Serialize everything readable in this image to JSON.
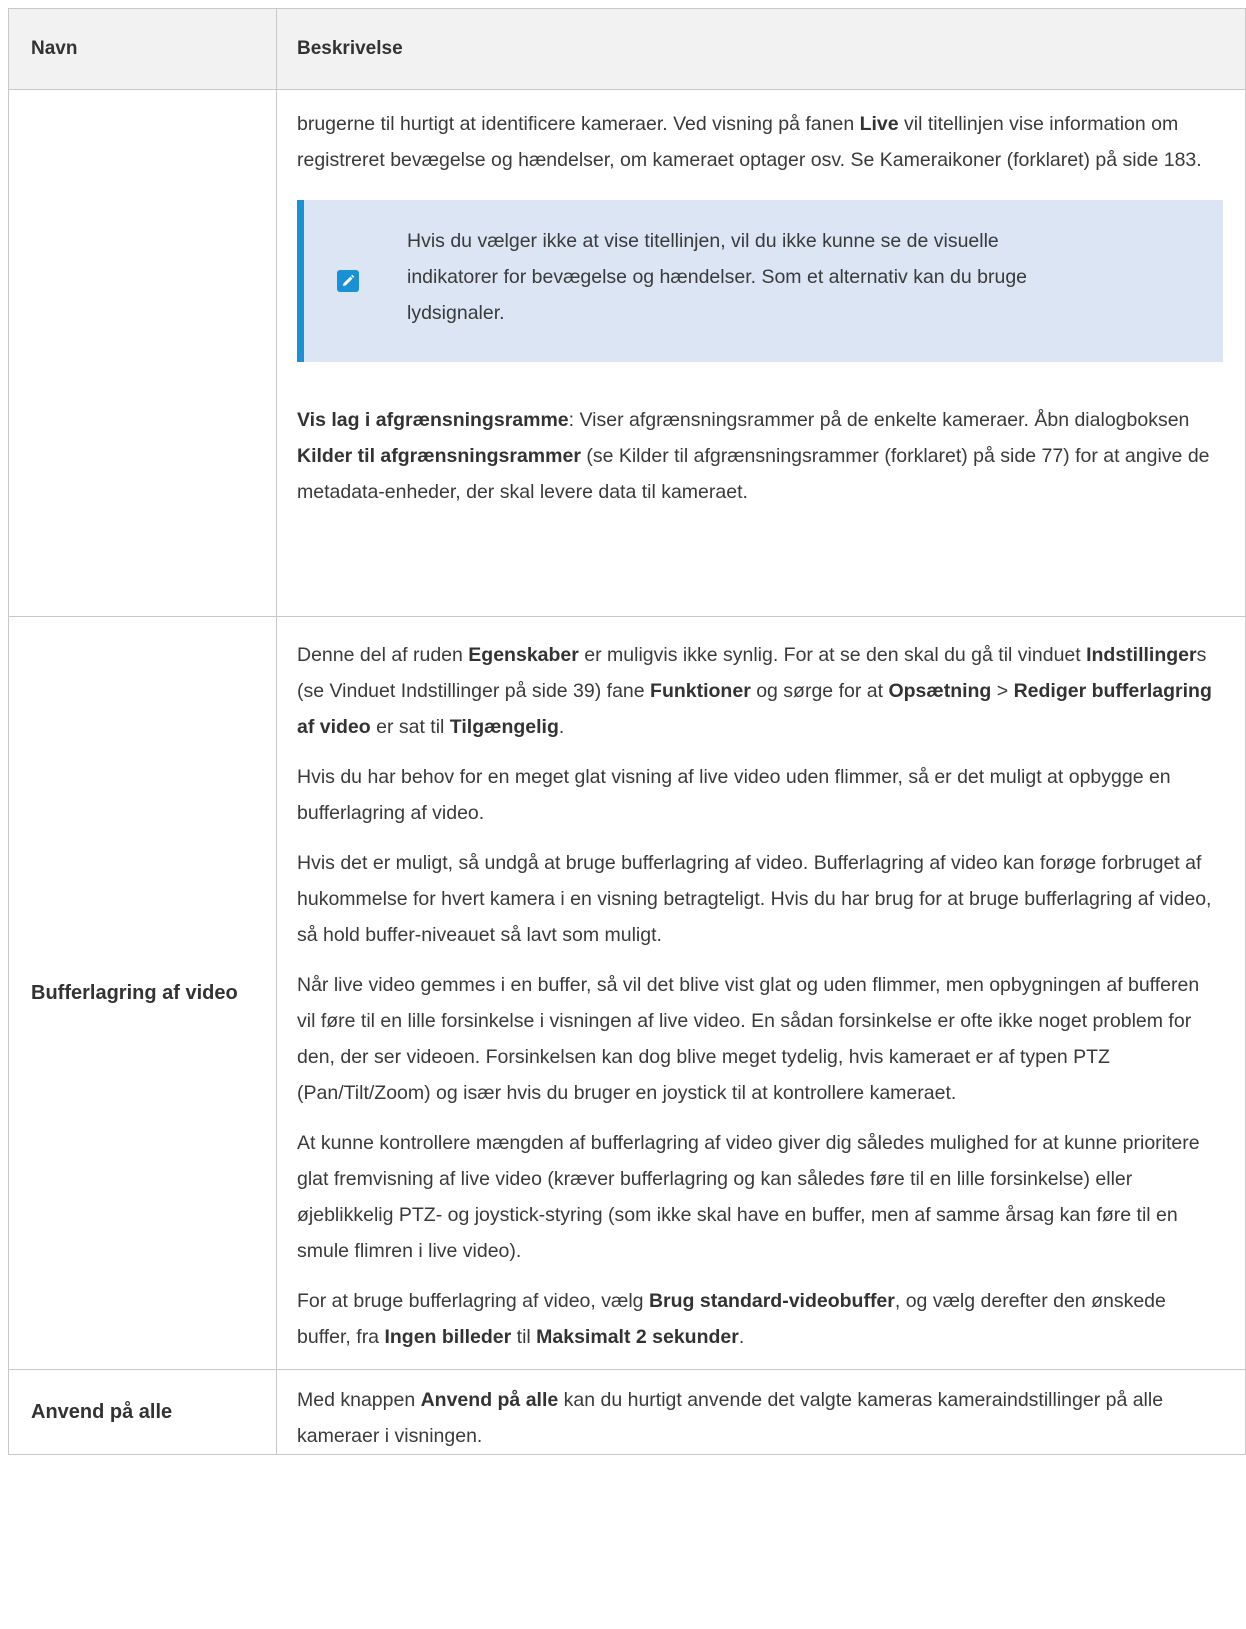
{
  "table": {
    "headers": {
      "name": "Navn",
      "description": "Beskrivelse"
    },
    "row1": {
      "p1": {
        "t1": "brugerne til hurtigt at identificere kameraer. Ved visning på fanen ",
        "b1": "Live",
        "t2": " vil titellinjen vise information om registreret bevægelse og hændelser, om kameraet optager osv. Se Kameraikoner (forklaret) på side 183."
      },
      "note": {
        "icon": "pencil-icon",
        "text": "Hvis du vælger ikke at vise titellinjen, vil du ikke kunne se de visuelle indikatorer for bevægelse og hændelser. Som et alternativ kan du bruge lydsignaler."
      },
      "p2": {
        "b1": "Vis lag i afgrænsningsramme",
        "t1": ": Viser afgrænsningsrammer på de enkelte kameraer. Åbn dialogboksen ",
        "b2": "Kilder til afgrænsningsrammer",
        "t2": " (se Kilder til afgrænsningsrammer (forklaret) på side 77) for at angive de metadata-enheder, der skal levere data til kameraet."
      }
    },
    "row2": {
      "name": "Bufferlagring af video",
      "p1": {
        "t1": "Denne del af ruden ",
        "b1": "Egenskaber",
        "t2": " er muligvis ikke synlig. For at se den skal du gå til vinduet ",
        "b2": "Indstillinger",
        "t3": "s (se Vinduet Indstillinger på side 39) fane ",
        "b3": "Funktioner",
        "t4": " og sørge for at ",
        "b4": "Opsætning",
        "t5": " > ",
        "b5": "Rediger bufferlagring af video",
        "t6": " er sat til ",
        "b6": "Tilgængelig",
        "t7": "."
      },
      "p2": "Hvis du har behov for en meget glat visning af live video uden flimmer, så er det muligt at opbygge en bufferlagring af video.",
      "p3": "Hvis det er muligt, så undgå at bruge bufferlagring af video. Bufferlagring af video kan forøge forbruget af hukommelse for hvert kamera i en visning betragteligt. Hvis du har brug for at bruge bufferlagring af video, så hold buffer-niveauet så lavt som muligt.",
      "p4": "Når live video gemmes i en buffer, så vil det blive vist glat og uden flimmer, men opbygningen af bufferen vil føre til en lille forsinkelse i visningen af live video. En sådan forsinkelse er ofte ikke noget problem for den, der ser videoen. Forsinkelsen kan dog blive meget tydelig, hvis kameraet er af typen PTZ (Pan/Tilt/Zoom) og især hvis du bruger en joystick til at kontrollere kameraet.",
      "p5": "At kunne kontrollere mængden af bufferlagring af video giver dig således mulighed for at kunne prioritere glat fremvisning af live video (kræver bufferlagring og kan således føre til en lille forsinkelse) eller øjeblikkelig PTZ- og joystick-styring (som ikke skal have en buffer, men af samme årsag kan føre til en smule flimren i live video).",
      "p6": {
        "t1": "For at bruge bufferlagring af video, vælg ",
        "b1": "Brug standard-videobuffer",
        "t2": ", og vælg derefter den ønskede buffer, fra ",
        "b2": "Ingen billeder",
        "t3": " til ",
        "b3": "Maksimalt 2 sekunder",
        "t4": "."
      }
    },
    "row3": {
      "name": "Anvend på alle",
      "p1": {
        "t1": "Med knappen ",
        "b1": "Anvend på alle",
        "t2": " kan du hurtigt anvende det valgte kameras kameraindstillinger på alle kameraer i visningen."
      }
    }
  }
}
